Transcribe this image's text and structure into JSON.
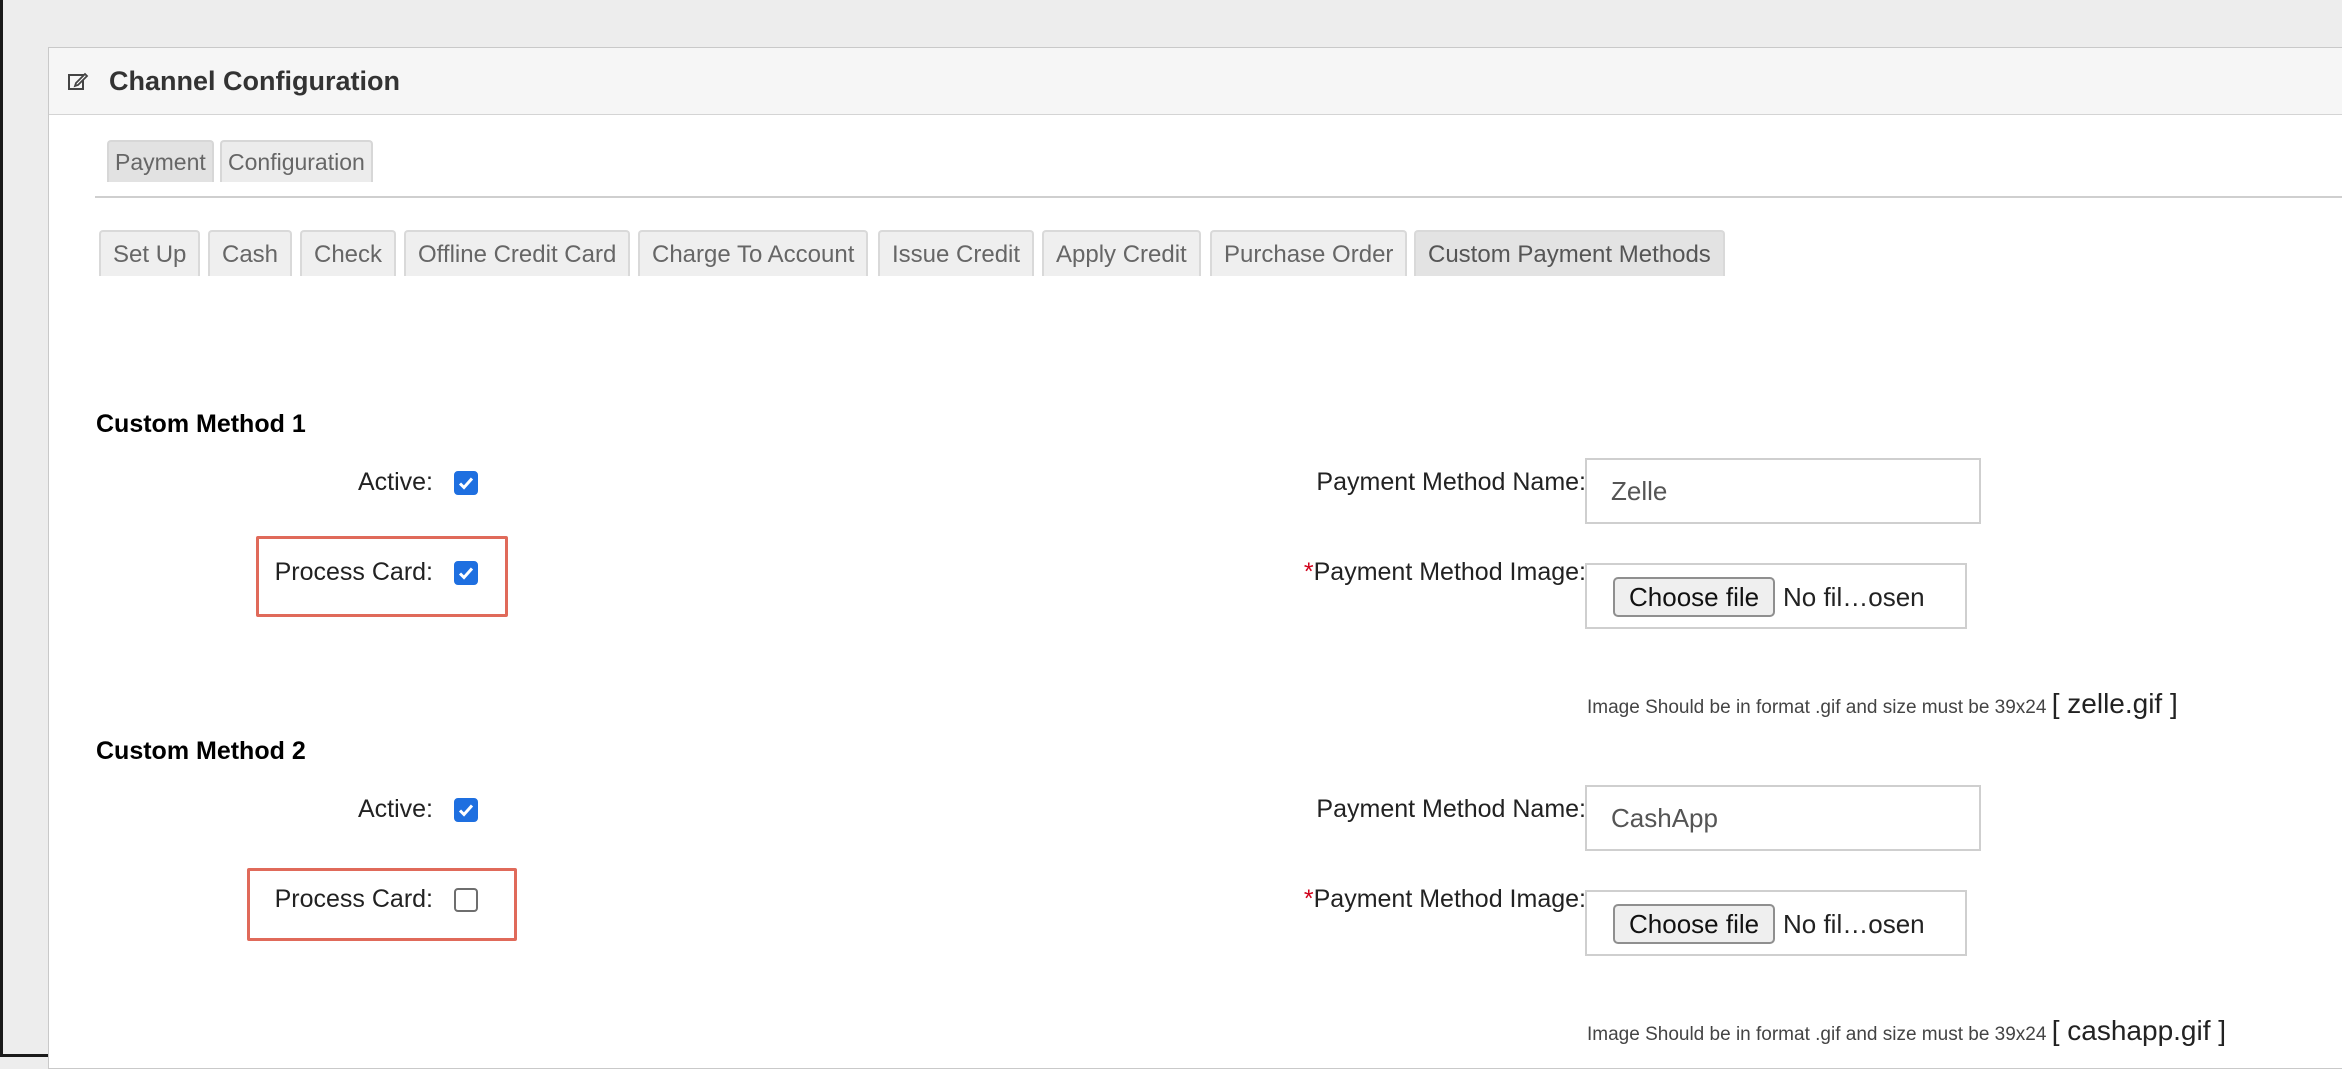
{
  "panel": {
    "title": "Channel Configuration",
    "icon": "edit-icon"
  },
  "top_tabs": [
    {
      "label": "Payment",
      "active": true
    },
    {
      "label": "Configuration",
      "active": false
    }
  ],
  "sub_tabs": [
    {
      "label": "Set Up",
      "active": false
    },
    {
      "label": "Cash",
      "active": false
    },
    {
      "label": "Check",
      "active": false
    },
    {
      "label": "Offline Credit Card",
      "active": false
    },
    {
      "label": "Charge To Account",
      "active": false
    },
    {
      "label": "Issue Credit",
      "active": false
    },
    {
      "label": "Apply Credit",
      "active": false
    },
    {
      "label": "Purchase Order",
      "active": false
    },
    {
      "label": "Custom Payment Methods",
      "active": true
    }
  ],
  "methods": [
    {
      "title": "Custom Method 1",
      "active_label": "Active:",
      "active": true,
      "process_card_label": "Process Card:",
      "process_card": true,
      "name_label": "Payment Method Name:",
      "name_value": "Zelle",
      "image_required_mark": "*",
      "image_label": "Payment Method Image:",
      "file_button": "Choose file",
      "file_status": "No fil…osen",
      "hint": "Image Should be in format .gif and size must be 39x24",
      "current_file": "[ zelle.gif ]"
    },
    {
      "title": "Custom Method 2",
      "active_label": "Active:",
      "active": true,
      "process_card_label": "Process Card:",
      "process_card": false,
      "name_label": "Payment Method Name:",
      "name_value": "CashApp",
      "image_required_mark": "*",
      "image_label": "Payment Method Image:",
      "file_button": "Choose file",
      "file_status": "No fil…osen",
      "hint": "Image Should be in format .gif and size must be 39x24",
      "current_file": "[ cashapp.gif ]"
    }
  ],
  "colors": {
    "checkbox_checked": "#1e6fe0",
    "highlight_border": "#e06a5a",
    "required_mark": "#d0021b"
  }
}
